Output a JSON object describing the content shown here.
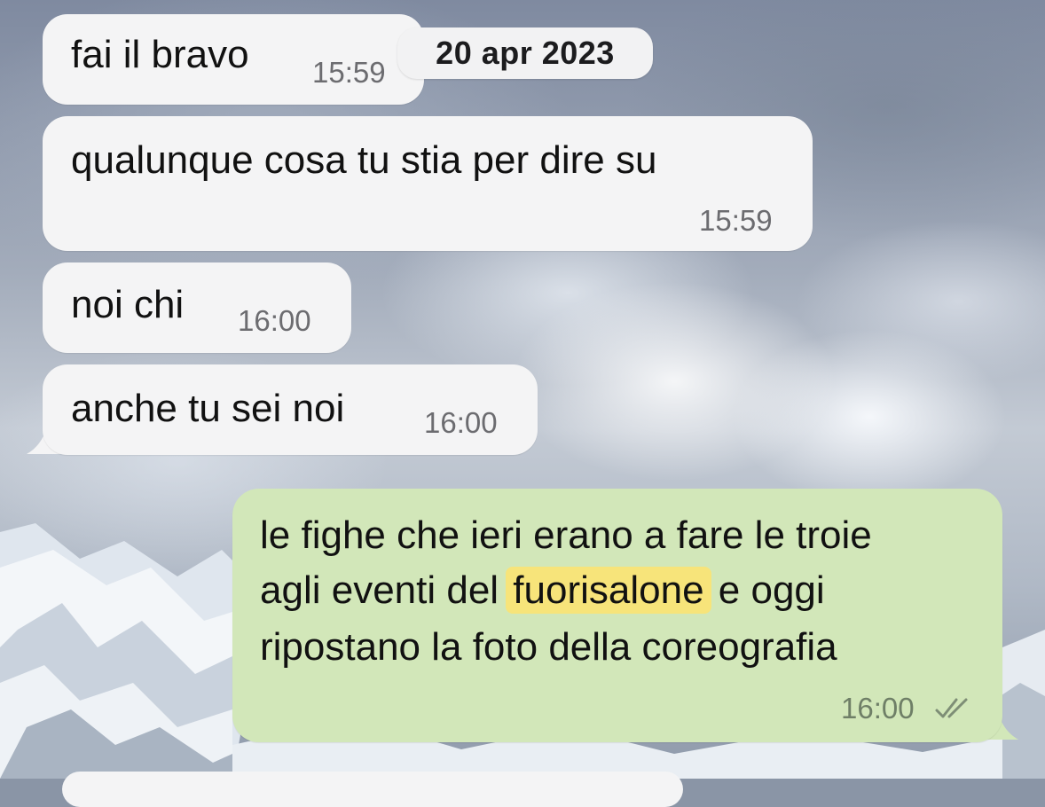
{
  "chat": {
    "date_separator": "20 apr 2023",
    "messages": [
      {
        "direction": "incoming",
        "text": "fai il bravo",
        "time": "15:59"
      },
      {
        "direction": "incoming",
        "text": "qualunque cosa tu stia per dire su",
        "time": "15:59"
      },
      {
        "direction": "incoming",
        "text": "noi chi",
        "time": "16:00"
      },
      {
        "direction": "incoming",
        "text": "anche tu sei noi",
        "time": "16:00"
      },
      {
        "direction": "outgoing",
        "line1": "le fighe che ieri erano a fare le troie",
        "line2_before": "agli eventi del ",
        "line2_highlight": "fuorisalone",
        "line2_after": " e oggi",
        "line3": "ripostano la foto della coreografia",
        "time": "16:00",
        "status_icon": "double-check-read-icon"
      }
    ]
  },
  "colors": {
    "incoming_bubble": "#f4f4f5",
    "outgoing_bubble": "#d2e7b9",
    "highlight": "#f7e47a"
  }
}
